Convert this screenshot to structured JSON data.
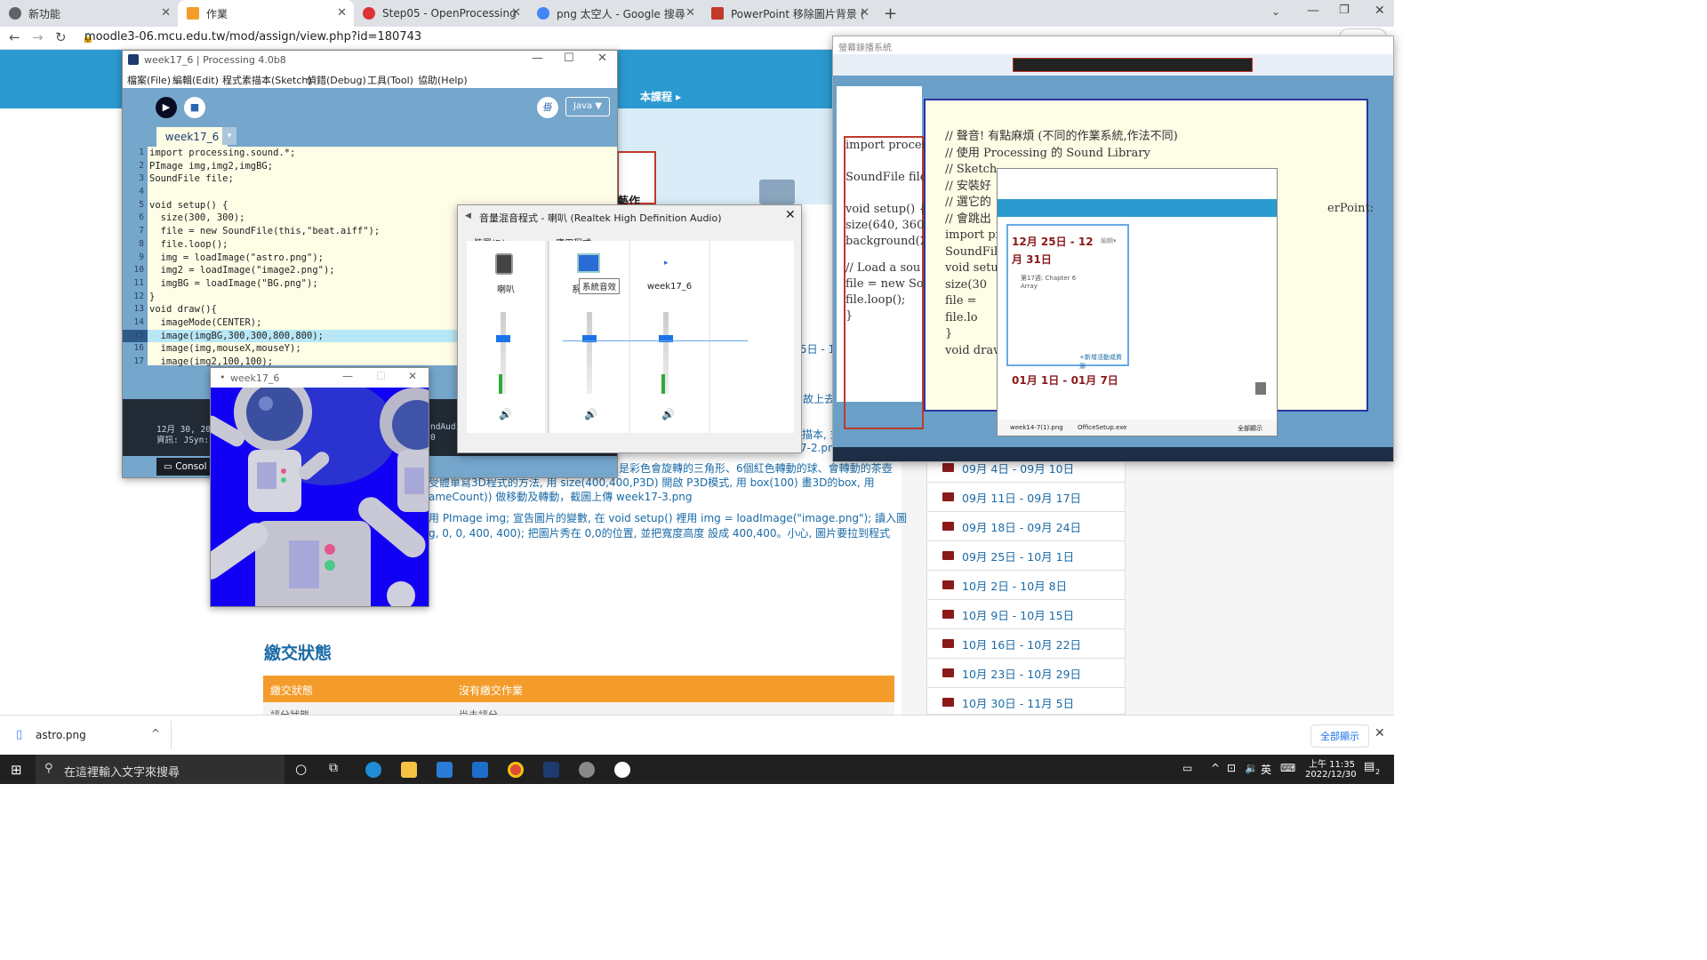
{
  "browser": {
    "tabs": [
      {
        "label": "新功能"
      },
      {
        "label": "作業"
      },
      {
        "label": "Step05 - OpenProcessing"
      },
      {
        "label": "png 太空人 - Google 搜尋"
      },
      {
        "label": "PowerPoint 移除圖片背景 (去背"
      }
    ],
    "url": "moodle3-06.mcu.edu.tw/mod/assign/view.php?id=180743"
  },
  "moodle": {
    "course_link": "本課程 ▸",
    "assign_partial": "藝作",
    "paragraphs": [
      "是彩色會旋轉的三角形、6個紅色轉動的球、會轉動的茶壺",
      "受體單寫3D程式的方法, 用 size(400,400,P3D) 開啟 P3D模式, 用 box(100) 畫3D的box, 用",
      "ameCount)) 做移動及轉動，截圖上傳 week17-3.png",
      "用 PImage img; 宣告圖片的變數, 在 void setup() 裡用 img = loadImage(\"image.png\"); 讀入圖",
      "g, 0, 0, 400, 400); 把圖片秀在 0,0的位置, 並把寬度高度 設成 400,400。小心, 圖片要拉到程式"
    ],
    "status_heading": "繳交狀態",
    "status_row": {
      "label": "繳交狀態",
      "value": "沒有繳交作業"
    },
    "next_row": {
      "label": "評分狀態",
      "value": "尚未評分"
    },
    "sidebar_weeks": [
      "09月 4日 - 09月 10日",
      "09月 11日 - 09月 17日",
      "09月 18日 - 09月 24日",
      "09月 25日 - 10月 1日",
      "10月 2日 - 10月 8日",
      "10月 9日 - 10月 15日",
      "10月 16日 - 10月 22日",
      "10月 23日 - 10月 29日",
      "10月 30日 - 11月 5日"
    ]
  },
  "processing": {
    "title": "week17_6 | Processing 4.0b8",
    "menu": [
      "檔案(File)",
      "編輯(Edit)",
      "程式素描本(Sketch)",
      "偵錯(Debug)",
      "工具(Tool)",
      "協助(Help)"
    ],
    "mode": "Java ▼",
    "tab": "week17_6",
    "lines": [
      "import processing.sound.*;",
      "PImage img,img2,imgBG;",
      "SoundFile file;",
      "",
      "void setup() {",
      "  size(300, 300);",
      "  file = new SoundFile(this,\"beat.aiff\");",
      "  file.loop();",
      "  img = loadImage(\"astro.png\");",
      "  img2 = loadImage(\"image2.png\");",
      "  imgBG = loadImage(\"BG.png\");",
      "}",
      "void draw(){",
      "  imageMode(CENTER);",
      "  image(imgBG,300,300,800,800);",
      "  image(img,mouseX,mouseY);",
      "  image(img2,100,100);"
    ],
    "line_numbers": [
      "1",
      "2",
      "3",
      "4",
      "5",
      "6",
      "7",
      "8",
      "9",
      "10",
      "11",
      "12",
      "13",
      "14",
      "15",
      "16",
      "17"
    ],
    "console_lines": [
      "12月 30, 202",
      "資訊: JSyn: "
    ],
    "console_right": [
      "ndAudio",
      "0"
    ],
    "console_tab": "Consol"
  },
  "sketch": {
    "title": "week17_6"
  },
  "mixer": {
    "title": "音量混音程式 - 喇叭 (Realtek High Definition Audio)",
    "device_label": "裝置(D)",
    "apps_label": "應用程式",
    "columns": [
      "喇叭",
      "系",
      "week17_6"
    ],
    "tooltip": "系統音效",
    "levels": {
      "speaker": 0.72,
      "system": 0.72,
      "week17_6": 0.72
    }
  },
  "capture": {
    "title": "螢幕錄播系統",
    "code_left": [
      "import processi",
      "SoundFile file;",
      "void setup() {",
      "  size(640, 360",
      "  background(25",
      "  // Load a sou",
      "  file = new So",
      "  file.loop();",
      "}"
    ],
    "code_right": [
      "// 聲音! 有點麻煩 (不同的作業系統,作法不同)",
      "// 使用 Processing 的 Sound Library",
      "// Sketch",
      "// 安裝好",
      "// 選它的",
      "// 會跳出",
      "import pro",
      "SoundFile",
      "void setup",
      "  size(30",
      "  file = ",
      "  file.lo",
      "}",
      "void draw"
    ],
    "inner_dates": [
      "12月 25日 - 12月 31日",
      "01月 1日 - 01月 7日"
    ],
    "inner_week": "第17週: Chapter 6",
    "inner_array": "Array",
    "inner_edit": "編輯▾",
    "inner_add": "+新增活動或資源",
    "inner_dl": "week14-7(1).png",
    "inner_dl2": "OfficeSetup.exe",
    "inner_showall": "全部顯示",
    "right_partial": "erPoint:"
  },
  "download": {
    "file": "astro.png",
    "show_all": "全部顯示"
  },
  "taskbar": {
    "search_placeholder": "在這裡輸入文字來搜尋",
    "ime": "英",
    "time": "上午 11:35",
    "date": "2022/12/30",
    "notifications": "2"
  },
  "colors": {
    "moodle_blue": "#2b9ad0",
    "status_orange": "#f39c2b",
    "pde_blue": "#75a6cc",
    "sketch_blue": "#1200f5"
  }
}
